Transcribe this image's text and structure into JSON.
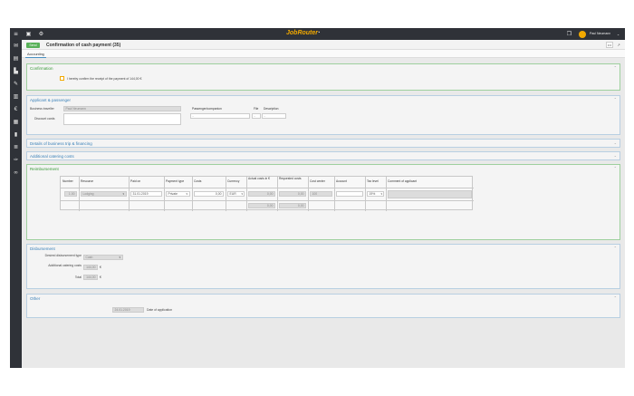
{
  "app": {
    "brand": "JobRouter",
    "brand_mark": "·",
    "user_name": "Paul Neumann"
  },
  "icons": [
    "menu-icon",
    "save-icon",
    "settings-icon",
    "window-icon",
    "avatar-icon",
    "chevron-down-icon"
  ],
  "toolbar": {
    "send_label": "Send",
    "title": "Confirmation of cash payment (35)",
    "more_label": "•••",
    "expand_label": "↗"
  },
  "tabs": [
    {
      "label": "Accounting"
    }
  ],
  "confirmation": {
    "title": "Confirmation",
    "checkbox_label": "I hereby confirm the receipt of the payment of 144,00 €"
  },
  "applicant": {
    "title": "Applicant & passenger",
    "business_traveller_label": "Business traveller",
    "business_traveller_value": "Paul Neumann",
    "discount_cards_label": "Discount cards",
    "passenger_header": "Passenger/companion",
    "file_header": "File",
    "description_header": "Description",
    "passenger_row_value": "-",
    "file_row_value": "-",
    "description_row_value": "-"
  },
  "details": {
    "title": "Details of business trip & financing"
  },
  "catering": {
    "title": "Additional catering costs"
  },
  "reimbursement": {
    "title": "Reimbursement",
    "columns": [
      "Number",
      "Resource",
      "Paid on",
      "Payment type",
      "Costs",
      "Currency",
      "Actual costs in €",
      "Requested costs",
      "Cost center",
      "Account",
      "Tax level",
      "Comment of applicant"
    ],
    "row": {
      "number": "1.00",
      "resource": "Lodging",
      "paid_on": "31.01.2019",
      "payment_type": "Private",
      "costs": "0,00",
      "currency": "EUR",
      "actual_costs": "0,00",
      "requested_costs": "0,00",
      "cost_center": "100",
      "account": "",
      "tax_level": "19%",
      "comment": ""
    },
    "totals": {
      "actual_costs": "0,00",
      "requested_costs": "0,00"
    }
  },
  "disbursement": {
    "title": "Disbursement",
    "type_label": "Desired disbursement type",
    "type_value": "Cash",
    "catering_label": "Additional catering costs",
    "catering_value": "144,00",
    "total_label": "Total",
    "total_value": "144,00",
    "currency_symbol": "€"
  },
  "other": {
    "title": "Other",
    "date_value": "24.01.2019",
    "date_label": "Date of application"
  }
}
